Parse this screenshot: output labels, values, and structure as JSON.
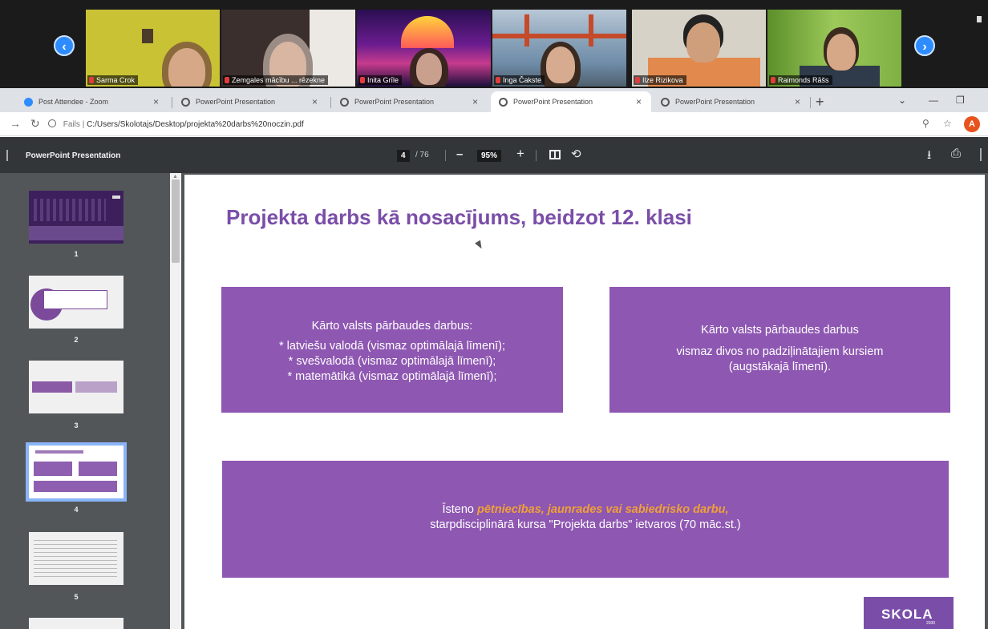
{
  "zoom": {
    "participants": [
      {
        "name": "Sarma Crok",
        "bg": "#c9c235",
        "skin": "#d6a888",
        "hair": "#8a6a3a"
      },
      {
        "name": "Zemgales mācību ... rēzekne",
        "bg": "#3a2f2c",
        "skin": "#d8b6a2",
        "hair": "#9b8c86"
      },
      {
        "name": "Inita Grīle",
        "bg": "#6a1c8f",
        "skin": "#c9a08e",
        "hair": "#3a2520"
      },
      {
        "name": "Inga Čakste",
        "bg": "#6f8ca8",
        "skin": "#d6ab8f",
        "hair": "#3a2a20"
      },
      {
        "name": "Ilze Rizikova",
        "bg": "#d7d2c7",
        "skin": "#cf9f7c",
        "hair": "#222222"
      },
      {
        "name": "Raimonds Rāšs",
        "bg": "#7fb043",
        "skin": "#d7a887",
        "hair": "#3b2a1e"
      }
    ]
  },
  "browser": {
    "tabs": [
      {
        "label": "Post Attendee - Zoom",
        "favicon": "zoom"
      },
      {
        "label": "PowerPoint Presentation",
        "favicon": "chrome"
      },
      {
        "label": "PowerPoint Presentation",
        "favicon": "chrome"
      },
      {
        "label": "PowerPoint Presentation",
        "favicon": "chrome"
      },
      {
        "label": "PowerPoint Presentation",
        "favicon": "chrome"
      }
    ],
    "active_tab": 3,
    "address": {
      "protocol": "Fails",
      "path": "C:/Users/Skolotajs/Desktop/projekta%20darbs%20noczin.pdf"
    },
    "profile_initial": "A"
  },
  "pdf": {
    "title": "PowerPoint Presentation",
    "current_page": "4",
    "total_pages": "/ 76",
    "zoom": "95%",
    "thumbnails": [
      "1",
      "2",
      "3",
      "4",
      "5"
    ]
  },
  "slide": {
    "title": "Projekta darbs kā nosacījums, beidzot 12. klasi",
    "box1": {
      "heading": "Kārto valsts pārbaudes darbus:",
      "lines": [
        "* latviešu valodā (vismaz optimālajā līmenī);",
        "* svešvalodā (vismaz optimālajā līmenī);",
        "* matemātikā (vismaz optimālajā līmenī);"
      ]
    },
    "box2": {
      "heading": "Kārto valsts pārbaudes darbus",
      "lines": [
        "vismaz divos no padziļinātajiem kursiem",
        "(augstākajā līmenī)."
      ]
    },
    "box3": {
      "prefix": "Īsteno ",
      "emphasis": "pētniecības, jaunrades vai sabiedrisko darbu,",
      "line2": "starpdisciplinārā kursa \"Projekta darbs\" ietvaros (70 māc.st.)"
    },
    "logo": {
      "text": "SKOLA",
      "sub": "2030"
    }
  },
  "colors": {
    "accent_purple": "#8e57b2",
    "title_purple": "#7a4ea8",
    "emphasis_orange": "#f0a037",
    "pdf_toolbar": "#323639",
    "zoom_blue": "#2d8cff"
  }
}
